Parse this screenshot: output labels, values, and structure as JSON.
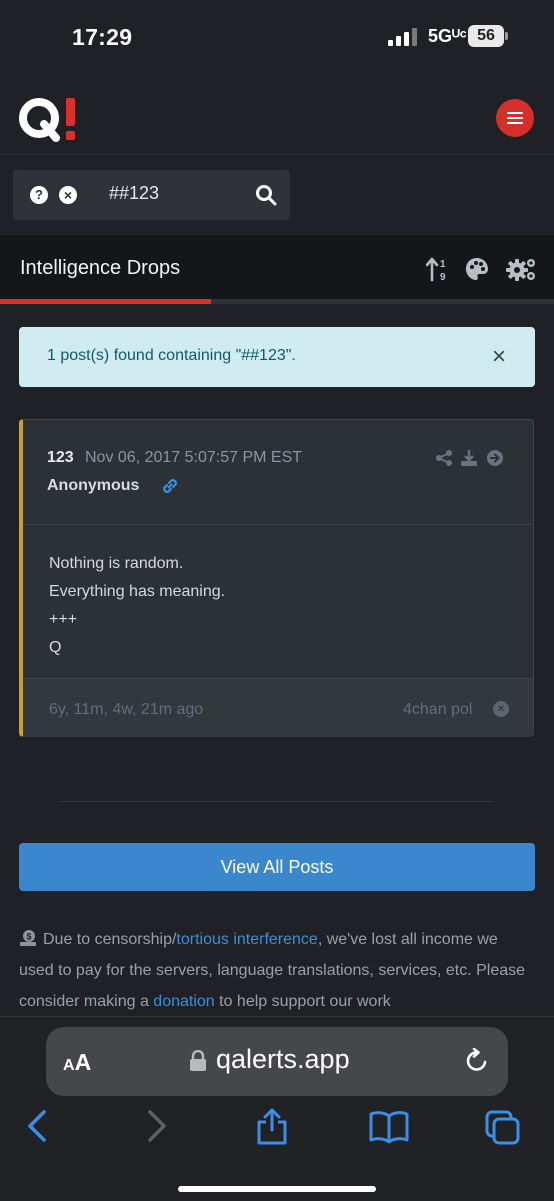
{
  "status_bar": {
    "time": "17:29",
    "network": "5Gᵁᶜ",
    "battery": "56"
  },
  "header": {
    "logo_text": "Q!"
  },
  "search": {
    "value": "##123"
  },
  "title_bar": {
    "title": "Intelligence Drops",
    "progress_fraction": 0.38
  },
  "alert": {
    "message": "1 post(s) found containing \"##123\"."
  },
  "post": {
    "id": "123",
    "date": "Nov 06, 2017 5:07:57 PM EST",
    "author": "Anonymous",
    "body_lines": [
      "Nothing is random.",
      "Everything has meaning.",
      "+++",
      "Q"
    ],
    "age": "6y, 11m, 4w, 21m ago",
    "source": "4chan pol"
  },
  "view_all_label": "View All Posts",
  "notice": {
    "part1": "Due to censorship/",
    "link1": "tortious interference",
    "part2": ", we've lost all income we used to pay for the servers, language translations, services, etc. Please consider making a ",
    "link2": "donation",
    "part3": " to help support our work"
  },
  "browser": {
    "aa_small": "A",
    "aa_big": "A",
    "url": "qalerts.app"
  },
  "colors": {
    "accent_red": "#d8302a",
    "link_blue": "#3b8fd6",
    "button_blue": "#3a87cd",
    "card_border_gold": "#c5a032",
    "alert_bg": "#d1ecf1"
  }
}
